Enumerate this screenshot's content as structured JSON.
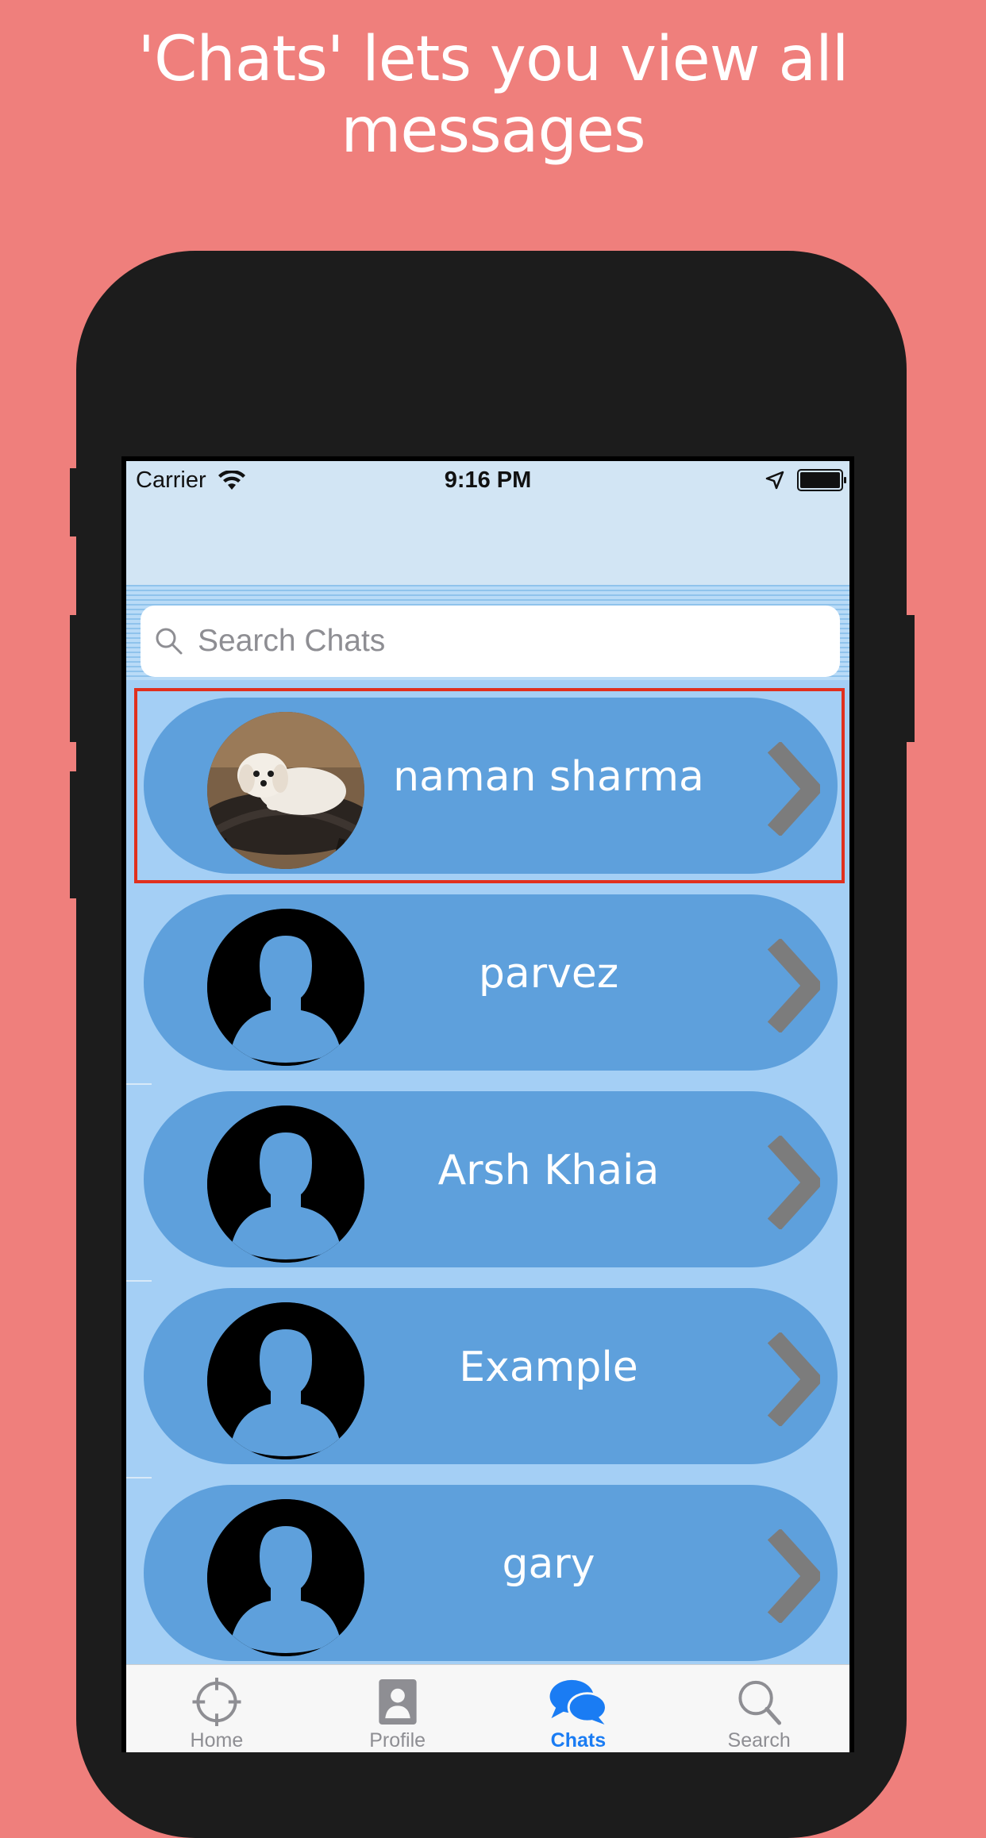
{
  "caption": "'Chats' lets you view all messages",
  "status_bar": {
    "carrier": "Carrier",
    "time": "9:16 PM"
  },
  "search": {
    "placeholder": "Search Chats"
  },
  "chats": [
    {
      "name": "naman sharma",
      "avatar": "dog-photo",
      "selected": true
    },
    {
      "name": "parvez",
      "avatar": "default-silhouette",
      "selected": false
    },
    {
      "name": "Arsh Khaia",
      "avatar": "default-silhouette",
      "selected": false
    },
    {
      "name": "Example",
      "avatar": "default-silhouette",
      "selected": false
    },
    {
      "name": "gary",
      "avatar": "default-silhouette",
      "selected": false
    }
  ],
  "tabs": [
    {
      "label": "Home",
      "icon": "crosshair-icon",
      "active": false
    },
    {
      "label": "Profile",
      "icon": "contact-card-icon",
      "active": false
    },
    {
      "label": "Chats",
      "icon": "chat-bubbles-icon",
      "active": true
    },
    {
      "label": "Search",
      "icon": "magnifier-icon",
      "active": false
    }
  ],
  "colors": {
    "background": "#ef7f7c",
    "row_pill": "#5ea0dc",
    "list_background": "#a4cff5",
    "selection_border": "#e0301e",
    "active_tab": "#1a7cf3"
  }
}
